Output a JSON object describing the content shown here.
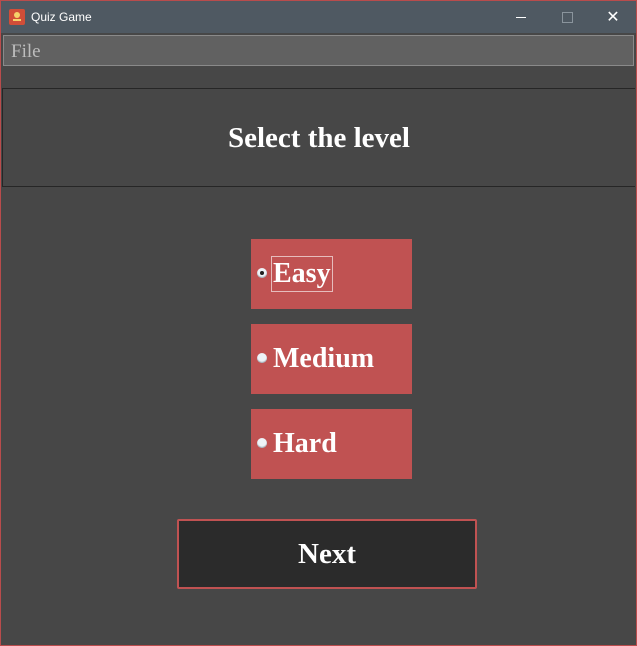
{
  "window": {
    "title": "Quiz Game",
    "icon": "quiz-app-icon",
    "controls": {
      "minimize": "minimize-icon",
      "maximize": "maximize-icon",
      "close": "close-icon",
      "close_glyph": "✕"
    }
  },
  "menu": {
    "items": [
      {
        "label": "File"
      }
    ]
  },
  "header": {
    "title": "Select the level"
  },
  "levels": {
    "selected": "Easy",
    "options": [
      {
        "label": "Easy",
        "checked": true
      },
      {
        "label": "Medium",
        "checked": false
      },
      {
        "label": "Hard",
        "checked": false
      }
    ]
  },
  "actions": {
    "next_label": "Next"
  },
  "colors": {
    "background": "#474747",
    "titlebar": "#4f5962",
    "accent": "#c05252",
    "button": "#2b2b2b",
    "text": "#ffffff"
  }
}
